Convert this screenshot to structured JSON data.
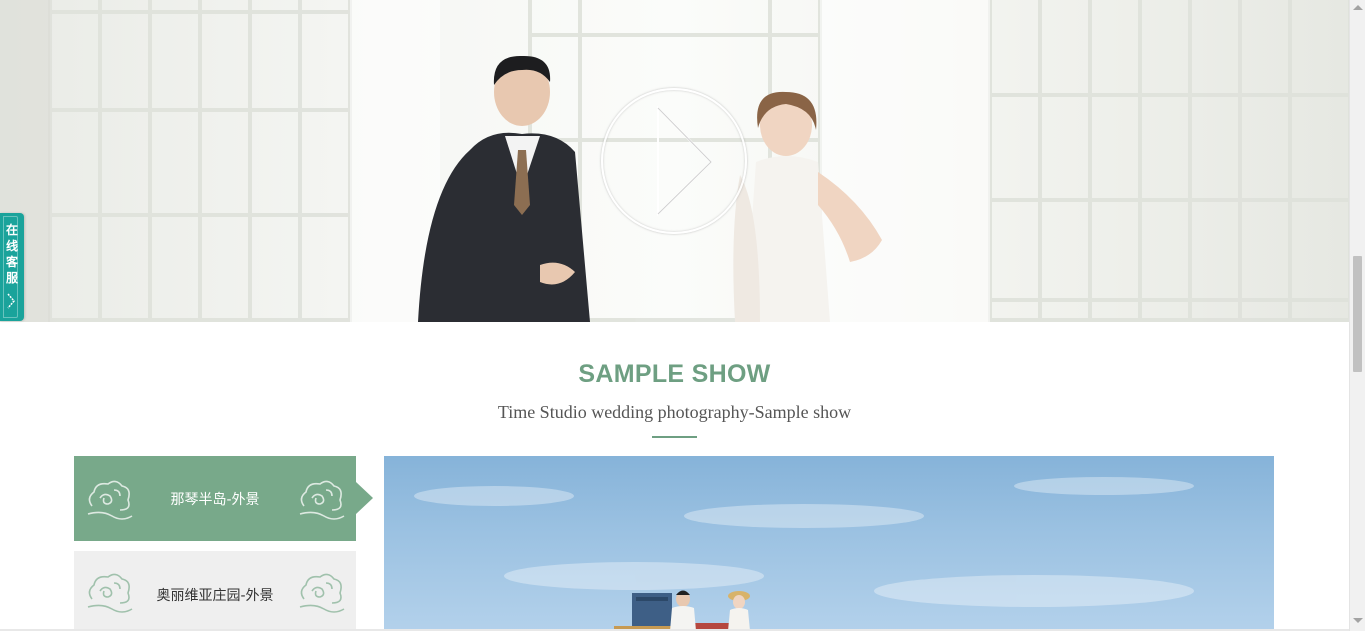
{
  "hero": {
    "play_icon": "play-icon"
  },
  "side_service": {
    "label": "在线客服",
    "icon": "chevron-right-icon",
    "color": "#1aa39b"
  },
  "section": {
    "title": "SAMPLE SHOW",
    "subtitle": "Time Studio wedding photography-Sample show",
    "accent_color": "#6e9f82"
  },
  "tabs": [
    {
      "label": "那琴半岛-外景",
      "active": true,
      "icon": "cloud-ornament-icon"
    },
    {
      "label": "奥丽维亚庄园-外景",
      "active": false,
      "icon": "cloud-ornament-icon"
    }
  ],
  "colors": {
    "tab_active_bg": "#78a98a",
    "tab_inactive_bg": "#efefef"
  }
}
